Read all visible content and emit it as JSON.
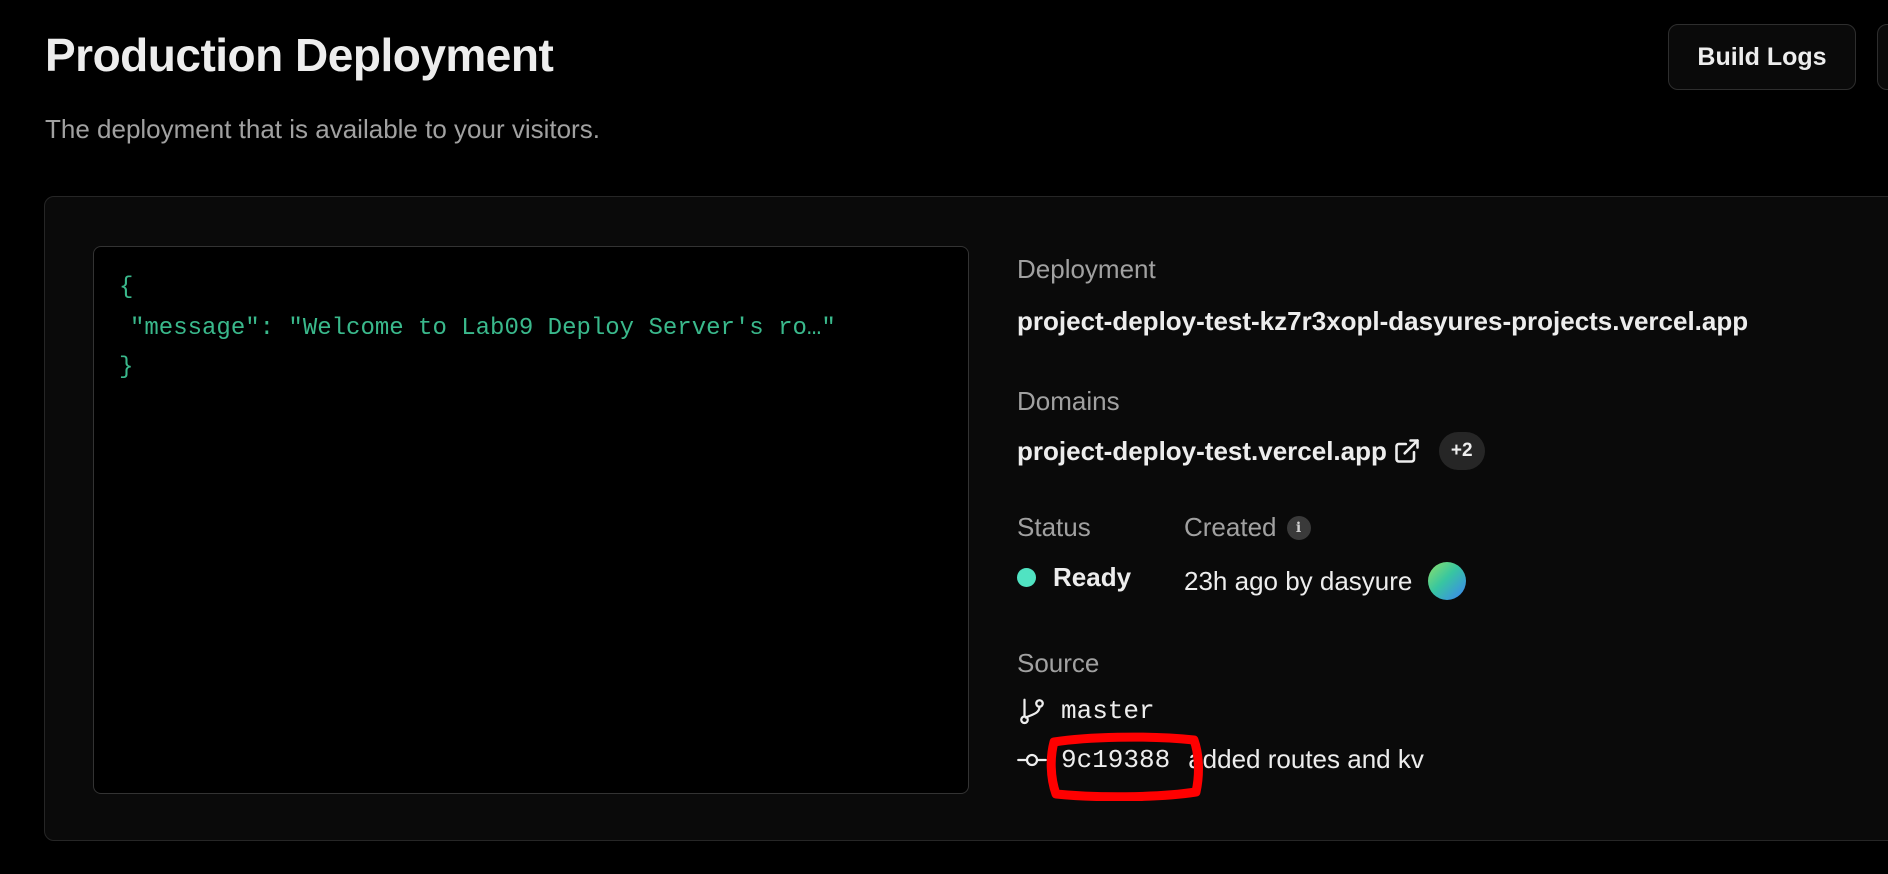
{
  "header": {
    "title": "Production Deployment",
    "subtitle": "The deployment that is available to your visitors.",
    "build_logs_label": "Build Logs"
  },
  "preview": {
    "lines": [
      "{",
      "\"message\": \"Welcome to Lab09 Deploy Server's ro…\"",
      "}"
    ]
  },
  "details": {
    "deployment_label": "Deployment",
    "deployment_url": "project-deploy-test-kz7r3xopl-dasyures-projects.vercel.app",
    "domains_label": "Domains",
    "domain": "project-deploy-test.vercel.app",
    "more_domains": "+2",
    "status_label": "Status",
    "status_value": "Ready",
    "status_color": "#50e3c2",
    "created_label": "Created",
    "info_icon_glyph": "i",
    "created_value": "23h ago by dasyure",
    "source_label": "Source",
    "branch": "master",
    "commit_hash": "9c19388",
    "commit_message": "added routes and kv"
  },
  "icons": {
    "external_link": "external-link-icon",
    "info": "info-icon",
    "branch": "git-branch-icon",
    "commit": "git-commit-icon"
  },
  "colors": {
    "background": "#000000",
    "card": "#0a0a0a",
    "code_green": "#3ab98c",
    "annotation_red": "#ff0000"
  }
}
